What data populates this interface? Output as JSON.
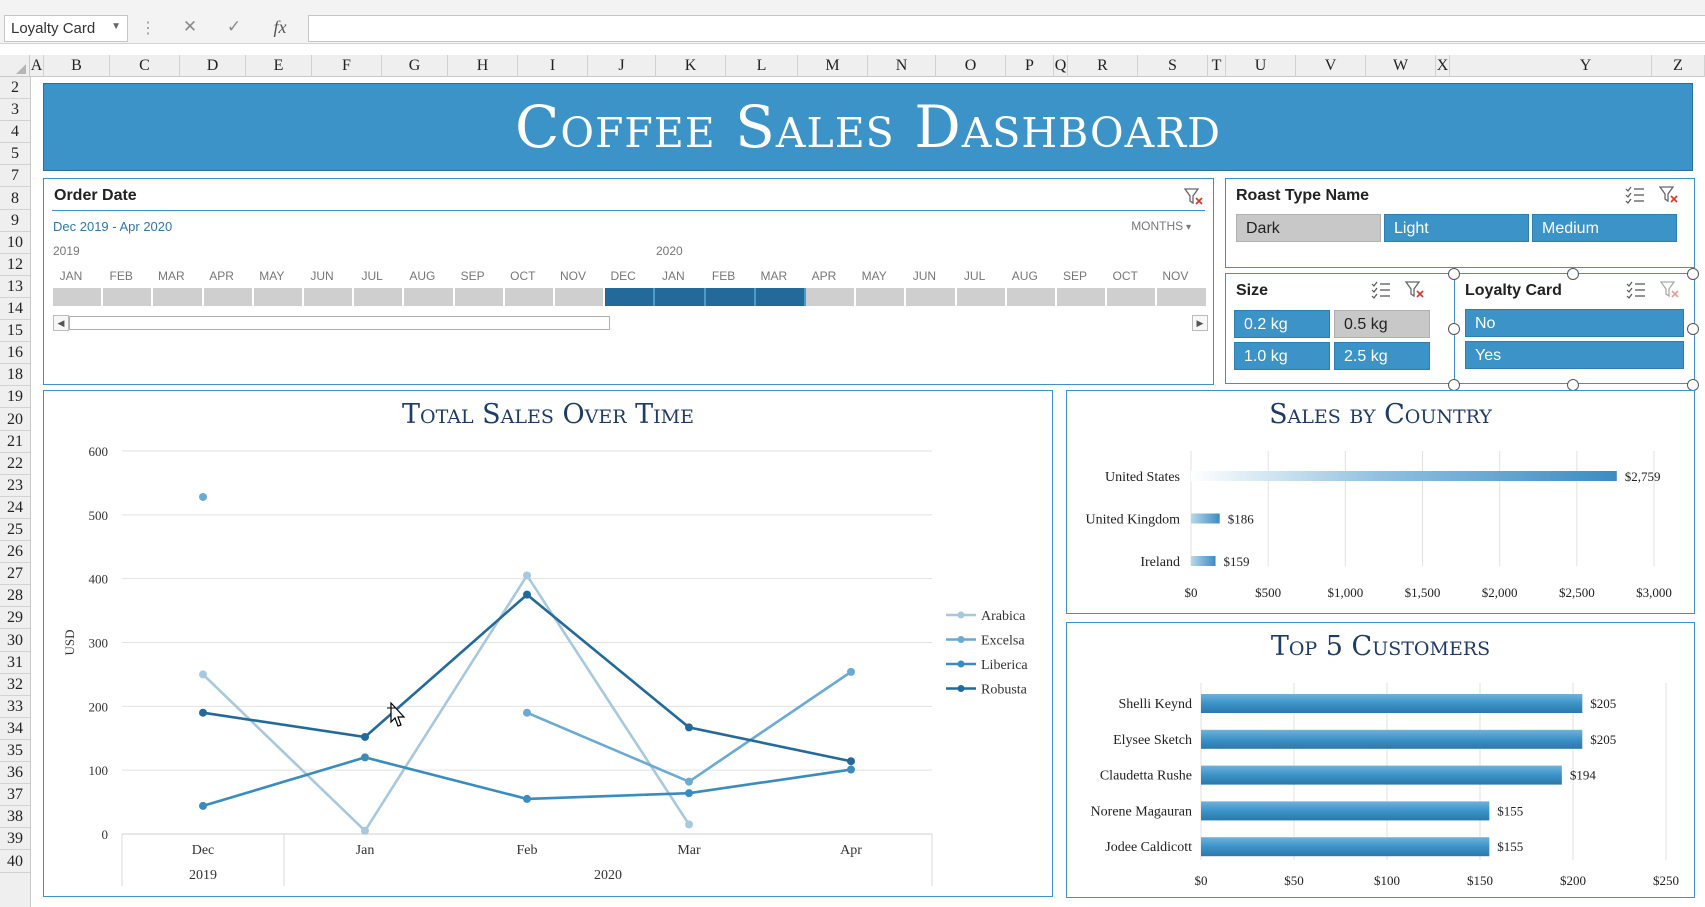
{
  "formula_bar": {
    "name_box": "Loyalty Card",
    "cancel_icon": "✕",
    "enter_icon": "✓",
    "fx_label": "fx",
    "formula": ""
  },
  "column_headers": [
    "A",
    "B",
    "C",
    "D",
    "E",
    "F",
    "G",
    "H",
    "I",
    "J",
    "K",
    "L",
    "M",
    "N",
    "O",
    "P",
    "Q",
    "R",
    "S",
    "T",
    "U",
    "V",
    "W",
    "X",
    "Y",
    "Z"
  ],
  "row_headers": [
    "2",
    "3",
    "4",
    "5",
    "7",
    "8",
    "9",
    "10",
    "12",
    "13",
    "14",
    "15",
    "16",
    "18",
    "19",
    "20",
    "21",
    "22",
    "23",
    "24",
    "25",
    "26",
    "27",
    "28",
    "29",
    "30",
    "31",
    "32",
    "33",
    "34",
    "35",
    "36",
    "37",
    "38",
    "39",
    "40"
  ],
  "dashboard": {
    "title": "Coffee Sales Dashboard"
  },
  "timeline": {
    "header": "Order Date",
    "range_label": "Dec 2019 - Apr 2020",
    "level": "MONTHS",
    "years": [
      "2019",
      "2020"
    ],
    "months": [
      "JAN",
      "FEB",
      "MAR",
      "APR",
      "MAY",
      "JUN",
      "JUL",
      "AUG",
      "SEP",
      "OCT",
      "NOV",
      "DEC",
      "JAN",
      "FEB",
      "MAR",
      "APR",
      "MAY",
      "JUN",
      "JUL",
      "AUG",
      "SEP",
      "OCT",
      "NOV"
    ],
    "selected_start": 11,
    "selected_end": 15
  },
  "roast_slicer": {
    "header": "Roast Type Name",
    "items": [
      {
        "label": "Dark",
        "selected": false
      },
      {
        "label": "Light",
        "selected": true
      },
      {
        "label": "Medium",
        "selected": true
      }
    ]
  },
  "size_slicer": {
    "header": "Size",
    "items": [
      {
        "label": "0.2 kg",
        "selected": true
      },
      {
        "label": "0.5 kg",
        "selected": false
      },
      {
        "label": "1.0 kg",
        "selected": true
      },
      {
        "label": "2.5 kg",
        "selected": true
      }
    ]
  },
  "loyalty_slicer": {
    "header": "Loyalty Card",
    "items": [
      {
        "label": "No",
        "selected": true
      },
      {
        "label": "Yes",
        "selected": true
      }
    ]
  },
  "colors": {
    "accent": "#3b93c7",
    "title_text": "#1f3c68",
    "arabica": "#a8c8dd",
    "excelsa": "#6aaad3",
    "liberica": "#3a8cbf",
    "robusta": "#236a9a"
  },
  "chart_data": [
    {
      "type": "line",
      "title": "Total Sales Over Time",
      "ylabel": "USD",
      "xlabel": "",
      "x": [
        "Dec",
        "Jan",
        "Feb",
        "Mar",
        "Apr"
      ],
      "x_groups": [
        {
          "label": "2019",
          "span": 1
        },
        {
          "label": "2020",
          "span": 4
        }
      ],
      "ylim": [
        0,
        600
      ],
      "yticks": [
        0,
        100,
        200,
        300,
        400,
        500,
        600
      ],
      "grid": true,
      "legend": "right",
      "series": [
        {
          "name": "Arabica",
          "values": [
            250,
            5,
            405,
            15,
            null
          ]
        },
        {
          "name": "Excelsa",
          "values": [
            528,
            null,
            190,
            82,
            254
          ]
        },
        {
          "name": "Liberica",
          "values": [
            44,
            120,
            55,
            64,
            101
          ]
        },
        {
          "name": "Robusta",
          "values": [
            190,
            152,
            375,
            167,
            114
          ]
        }
      ]
    },
    {
      "type": "bar",
      "orientation": "horizontal",
      "title": "Sales by Country",
      "categories": [
        "United States",
        "United Kingdom",
        "Ireland"
      ],
      "values": [
        2759,
        186,
        159
      ],
      "value_labels": [
        "$2,759",
        "$186",
        "$159"
      ],
      "xlim": [
        0,
        3000
      ],
      "xticks": [
        "$0",
        "$500",
        "$1,000",
        "$1,500",
        "$2,000",
        "$2,500",
        "$3,000"
      ],
      "tick_values": [
        0,
        500,
        1000,
        1500,
        2000,
        2500,
        3000
      ]
    },
    {
      "type": "bar",
      "orientation": "horizontal",
      "title": "Top 5 Customers",
      "categories": [
        "Shelli Keynd",
        "Elysee Sketch",
        "Claudetta Rushe",
        "Norene Magauran",
        "Jodee Caldicott"
      ],
      "values": [
        205,
        205,
        194,
        155,
        155
      ],
      "value_labels": [
        "$205",
        "$205",
        "$194",
        "$155",
        "$155"
      ],
      "xlim": [
        0,
        250
      ],
      "xticks": [
        "$0",
        "$50",
        "$100",
        "$150",
        "$200",
        "$250"
      ],
      "tick_values": [
        0,
        50,
        100,
        150,
        200,
        250
      ]
    }
  ]
}
